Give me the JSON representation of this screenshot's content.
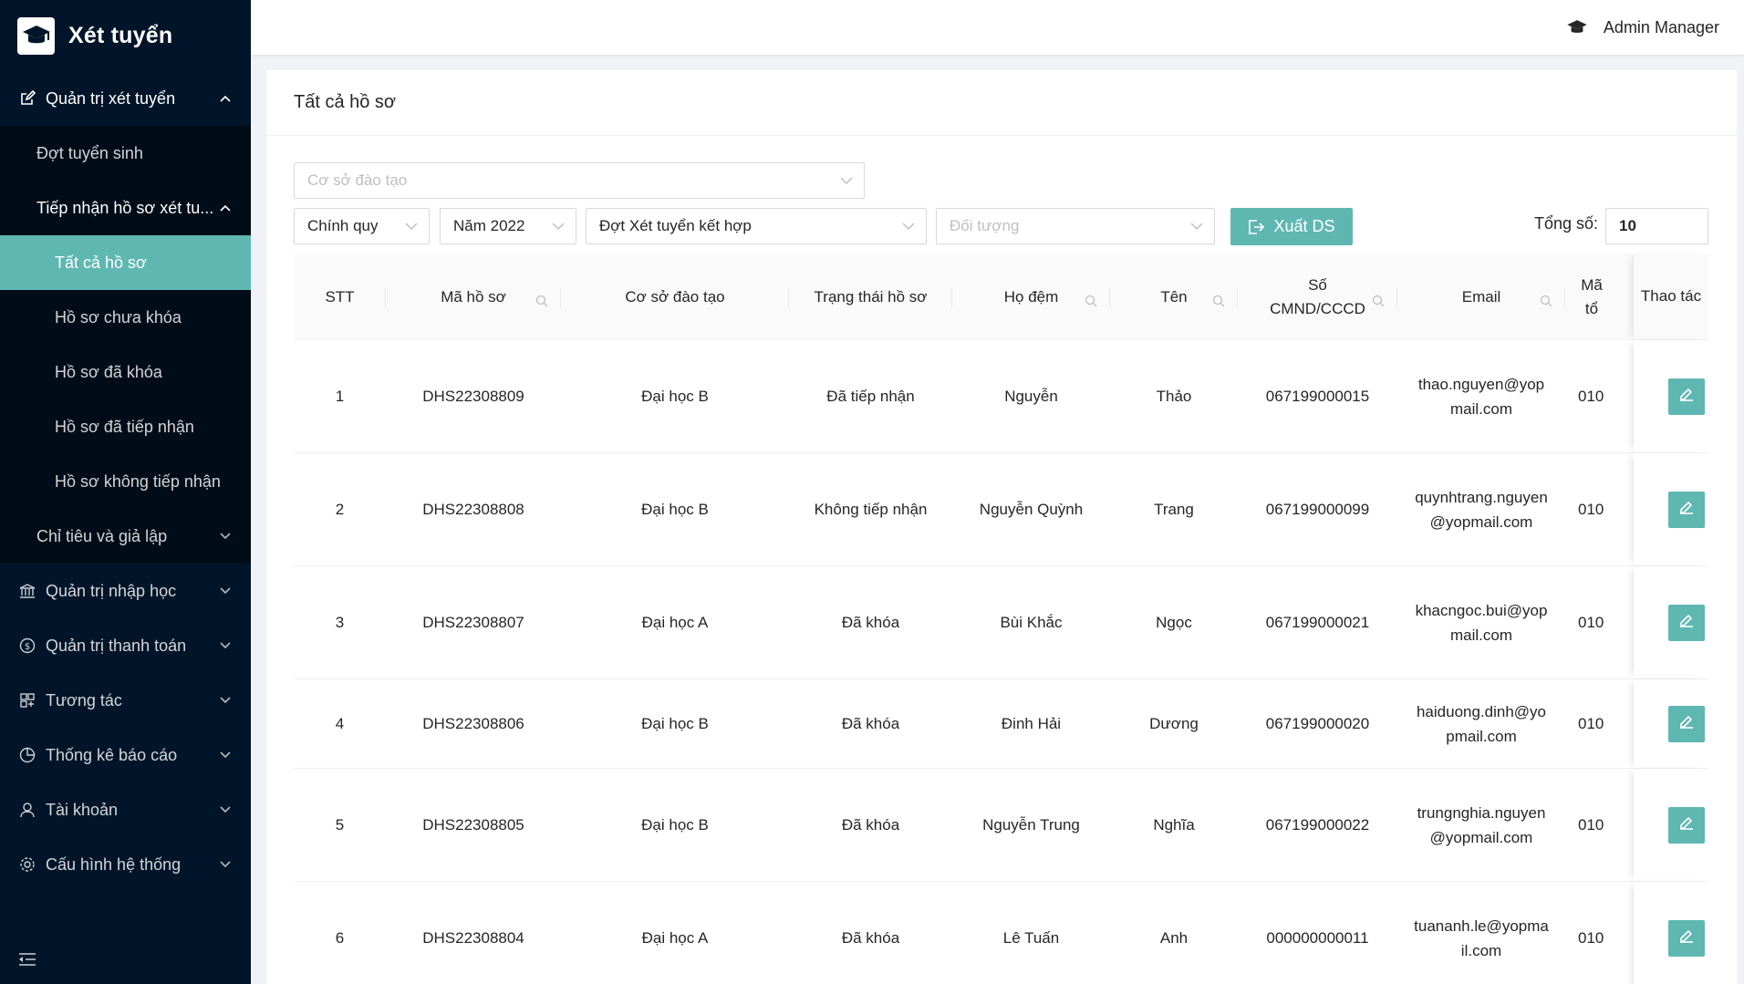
{
  "app": {
    "title": "Xét tuyển"
  },
  "header": {
    "user_name": "Admin Manager"
  },
  "sidebar": {
    "items": [
      {
        "label": "Quản trị xét tuyển",
        "icon": "edit-square-icon"
      },
      {
        "label": "Đợt tuyển sinh"
      },
      {
        "label": "Tiếp nhận hồ sơ xét tu..."
      },
      {
        "label": "Tất cả hồ sơ"
      },
      {
        "label": "Hồ sơ chưa khóa"
      },
      {
        "label": "Hồ sơ đã khóa"
      },
      {
        "label": "Hồ sơ đã tiếp nhận"
      },
      {
        "label": "Hồ sơ không tiếp nhận"
      },
      {
        "label": "Chỉ tiêu và giả lập"
      },
      {
        "label": "Quản trị nhập học",
        "icon": "bank-icon"
      },
      {
        "label": "Quản trị thanh toán",
        "icon": "dollar-circle-icon"
      },
      {
        "label": "Tương tác",
        "icon": "layout-icon"
      },
      {
        "label": "Thống kê báo cáo",
        "icon": "pie-chart-icon"
      },
      {
        "label": "Tài khoản",
        "icon": "user-icon"
      },
      {
        "label": "Cấu hình hệ thống",
        "icon": "gear-icon"
      }
    ]
  },
  "page": {
    "title": "Tất cả hồ sơ"
  },
  "filters": {
    "facility_placeholder": "Cơ sở đào tạo",
    "system": "Chính quy",
    "year": "Năm 2022",
    "round": "Đợt Xét tuyển kết hợp",
    "target_placeholder": "Đối tượng",
    "export_label": "Xuất DS",
    "total_label": "Tổng số:",
    "total_value": "10"
  },
  "table": {
    "columns": [
      "STT",
      "Mã hồ sơ",
      "Cơ sở đào tạo",
      "Trạng thái hồ sơ",
      "Họ đệm",
      "Tên",
      "Số CMND/CCCD",
      "Email",
      "Mã tổ",
      "Thao tác"
    ],
    "rows": [
      {
        "stt": "1",
        "code": "DHS22308809",
        "facility": "Đại học B",
        "status": "Đã tiếp nhận",
        "middle": "Nguyễn",
        "first": "Thảo",
        "id": "067199000015",
        "email": "thao.nguyen@yopmail.com",
        "extra": "010"
      },
      {
        "stt": "2",
        "code": "DHS22308808",
        "facility": "Đại học B",
        "status": "Không tiếp nhận",
        "middle": "Nguyễn Quỳnh",
        "first": "Trang",
        "id": "067199000099",
        "email": "quynhtrang.nguyen@yopmail.com",
        "extra": "010"
      },
      {
        "stt": "3",
        "code": "DHS22308807",
        "facility": "Đại học A",
        "status": "Đã khóa",
        "middle": "Bùi Khắc",
        "first": "Ngọc",
        "id": "067199000021",
        "email": "khacngoc.bui@yopmail.com",
        "extra": "010"
      },
      {
        "stt": "4",
        "code": "DHS22308806",
        "facility": "Đại học B",
        "status": "Đã khóa",
        "middle": "Đinh Hải",
        "first": "Dương",
        "id": "067199000020",
        "email": "haiduong.dinh@yopmail.com",
        "extra": "010"
      },
      {
        "stt": "5",
        "code": "DHS22308805",
        "facility": "Đại học B",
        "status": "Đã khóa",
        "middle": "Nguyễn Trung",
        "first": "Nghĩa",
        "id": "067199000022",
        "email": "trungnghia.nguyen@yopmail.com",
        "extra": "010"
      },
      {
        "stt": "6",
        "code": "DHS22308804",
        "facility": "Đại học A",
        "status": "Đã khóa",
        "middle": "Lê Tuấn",
        "first": "Anh",
        "id": "000000000011",
        "email": "tuananh.le@yopmail.com",
        "extra": "010"
      }
    ]
  },
  "colors": {
    "accent": "#5fb7b2",
    "sidebar_bg": "#001529",
    "submenu_bg": "#000c17"
  }
}
